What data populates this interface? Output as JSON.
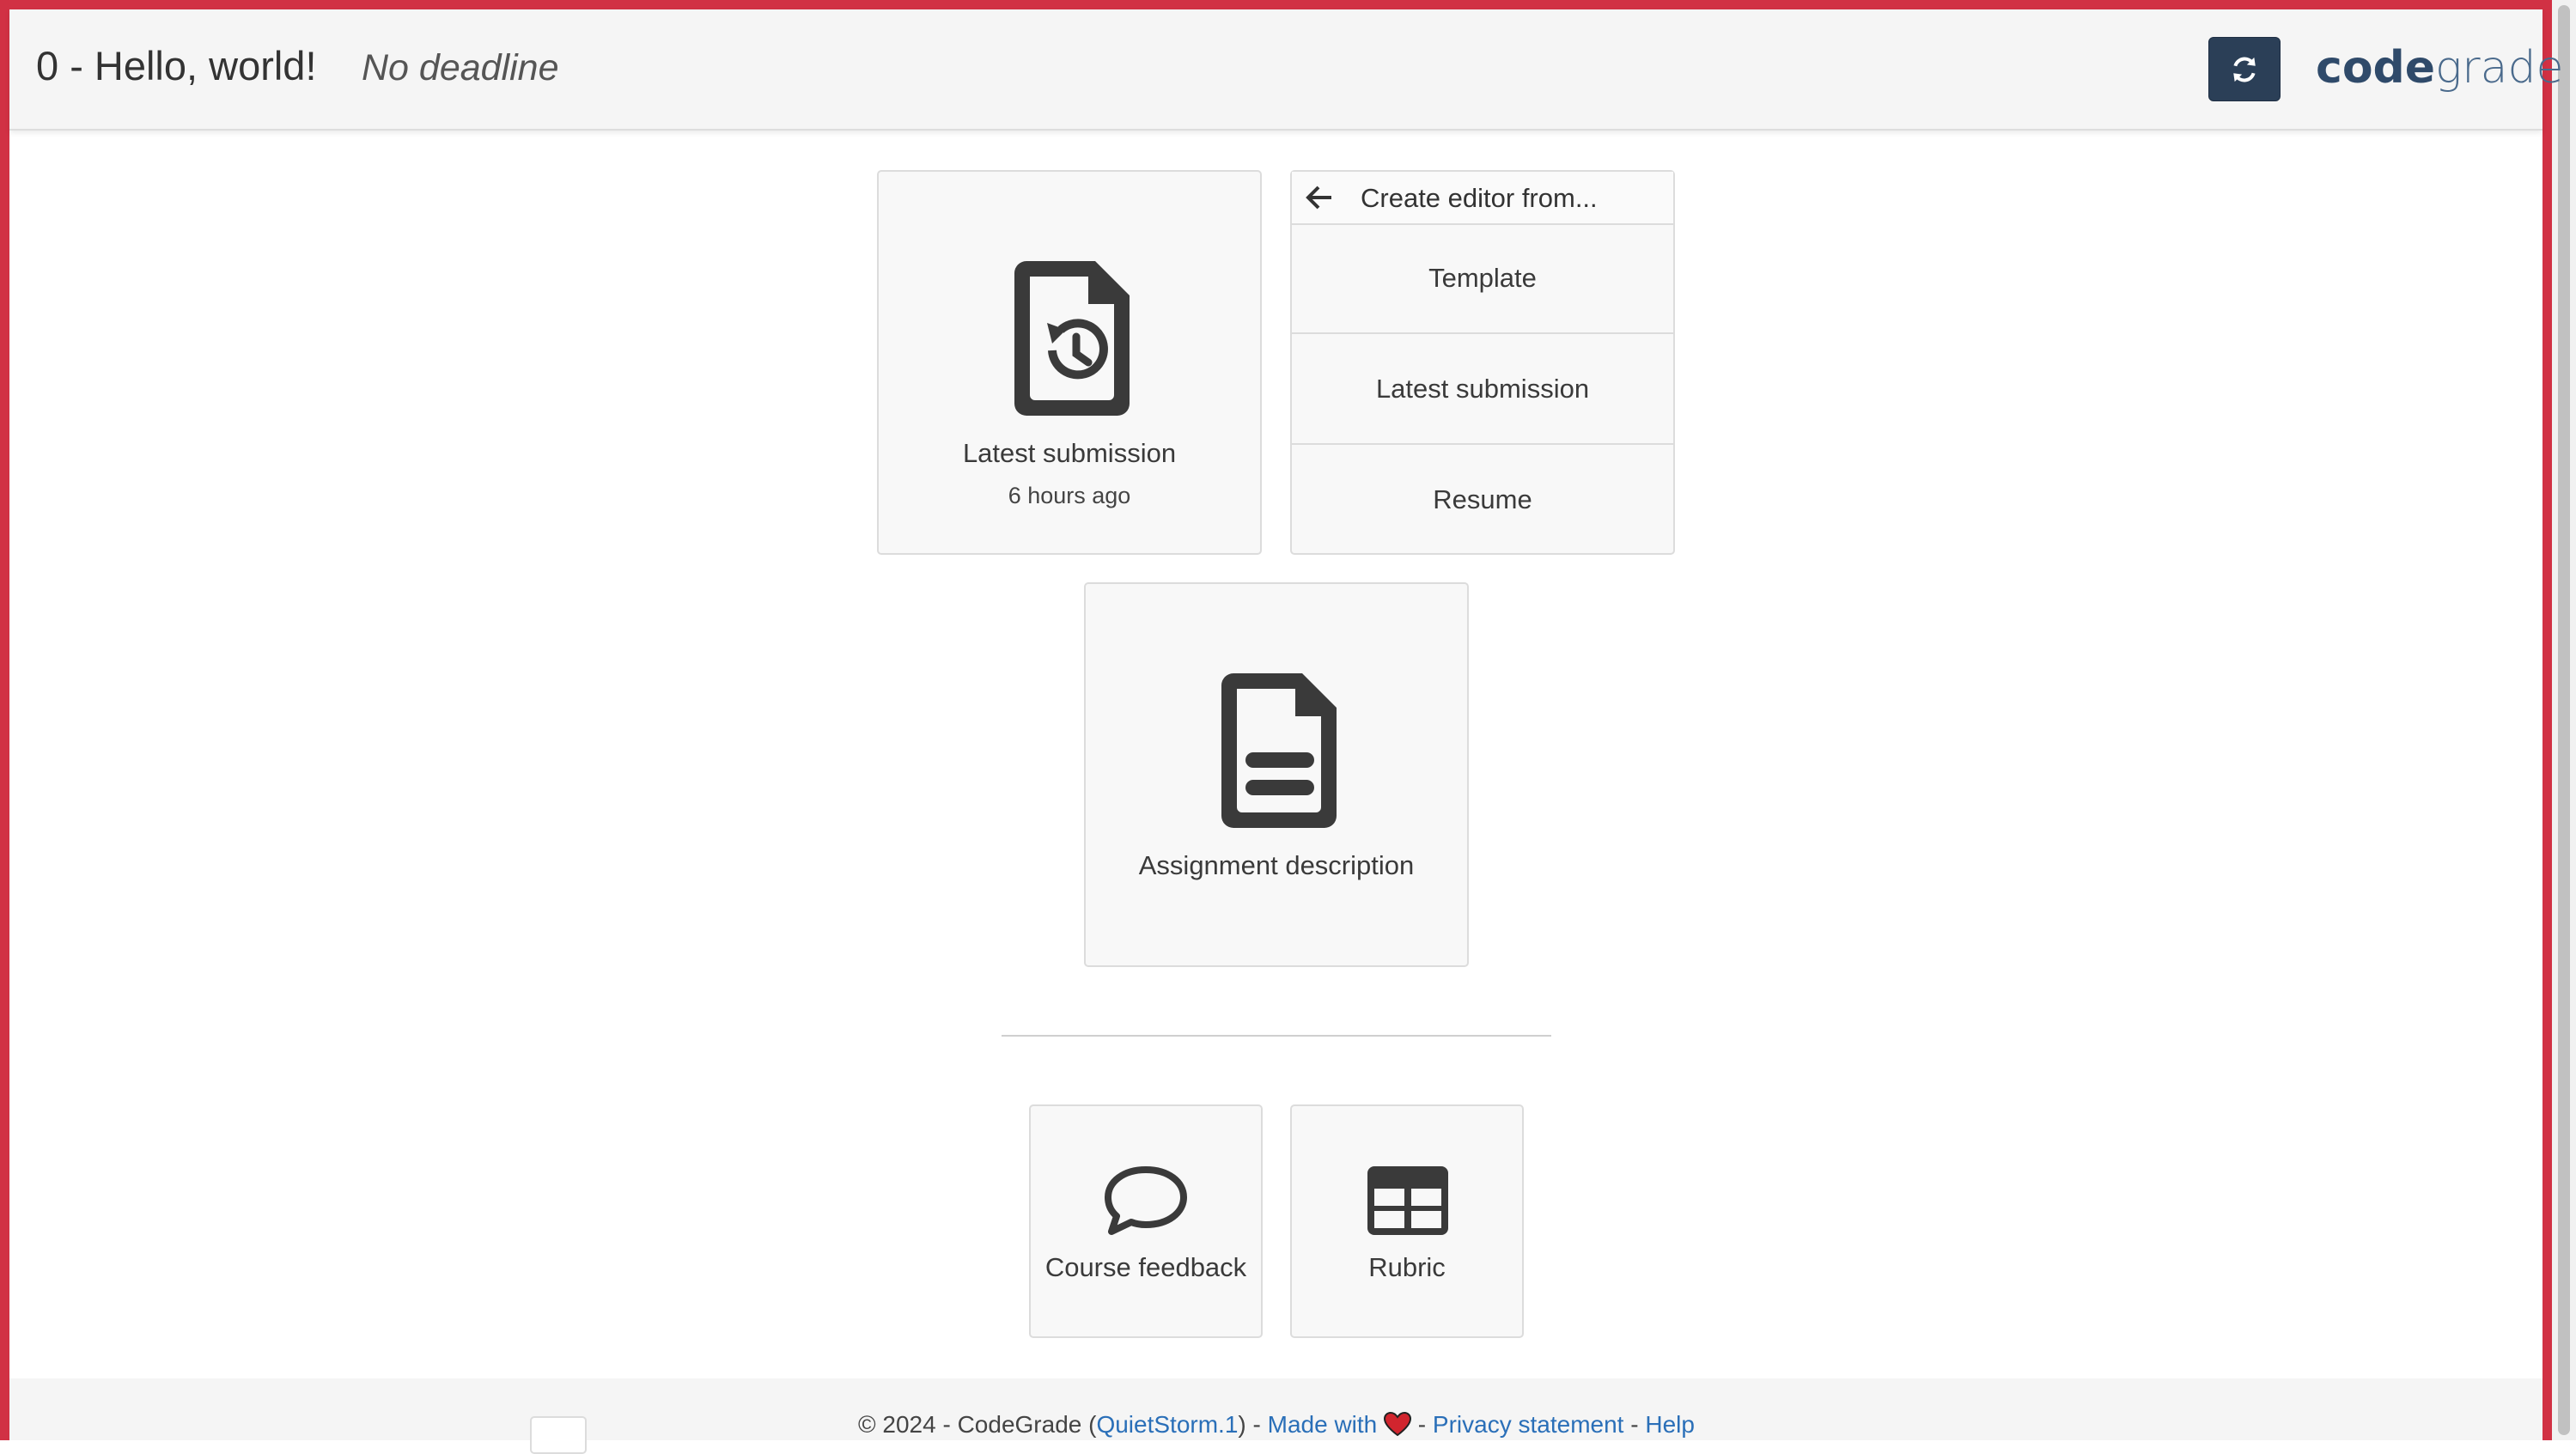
{
  "header": {
    "title": "0 - Hello, world!",
    "deadline": "No deadline",
    "logo_code": "codegrade",
    "refresh_icon": "refresh-icon"
  },
  "cards": {
    "latest_submission": {
      "label": "Latest submission",
      "time": "6 hours ago",
      "icon": "file-history-icon"
    },
    "assignment_description": {
      "label": "Assignment description",
      "icon": "file-text-icon"
    },
    "course_feedback": {
      "label": "Course feedback",
      "icon": "speech-bubble-icon"
    },
    "rubric": {
      "label": "Rubric",
      "icon": "table-icon"
    }
  },
  "editor_menu": {
    "header": "Create editor from...",
    "back_icon": "arrow-left-icon",
    "items": [
      "Template",
      "Latest submission",
      "Resume"
    ]
  },
  "footer": {
    "prefix": "© 2024 - CodeGrade (",
    "version": "QuietStorm.1",
    "after_version": ") - ",
    "made_with": "Made with",
    "sep1": " - ",
    "privacy": "Privacy statement",
    "sep2": " - ",
    "help": "Help"
  },
  "colors": {
    "accent_frame": "#d13144",
    "refresh_button": "#2b3f57",
    "link": "#2a6fb8",
    "icon": "#3a3a3a"
  }
}
